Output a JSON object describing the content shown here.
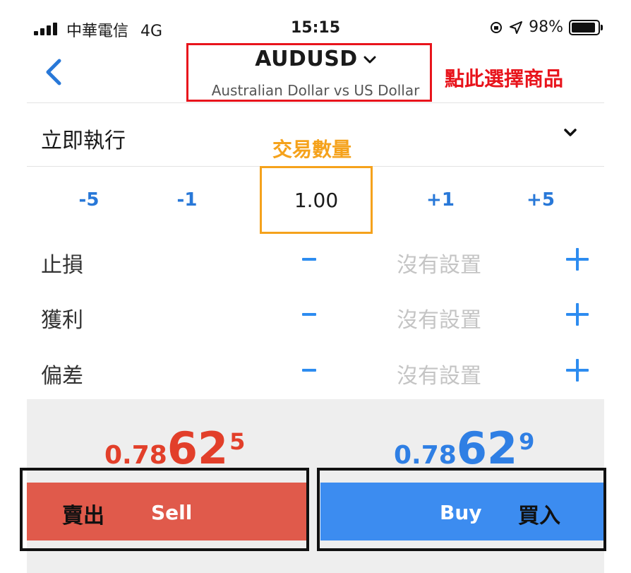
{
  "status_bar": {
    "carrier": "中華電信",
    "network": "4G",
    "time": "15:15",
    "battery": "98%"
  },
  "header": {
    "symbol": "AUDUSD",
    "description": "Australian Dollar vs US Dollar",
    "annotation": "點此選擇商品"
  },
  "order_type": {
    "label": "立即執行"
  },
  "volume": {
    "annotation": "交易數量",
    "value": "1.00",
    "steps": [
      "-5",
      "-1",
      "+1",
      "+5"
    ]
  },
  "fields": [
    {
      "label": "止損",
      "value": "沒有設置"
    },
    {
      "label": "獲利",
      "value": "沒有設置"
    },
    {
      "label": "偏差",
      "value": "沒有設置"
    }
  ],
  "prices": {
    "sell": {
      "prefix": "0.78",
      "big": "62",
      "sup": "5"
    },
    "buy": {
      "prefix": "0.78",
      "big": "62",
      "sup": "9"
    }
  },
  "buttons": {
    "sell_cn": "賣出",
    "sell": "Sell",
    "buy": "Buy",
    "buy_cn": "買入"
  },
  "colors": {
    "accent_blue": "#2d8cf0",
    "sell_red": "#e05a4b",
    "buy_blue": "#3c8cf0",
    "annotation_red": "#e8141c",
    "annotation_orange": "#f5a21c"
  }
}
